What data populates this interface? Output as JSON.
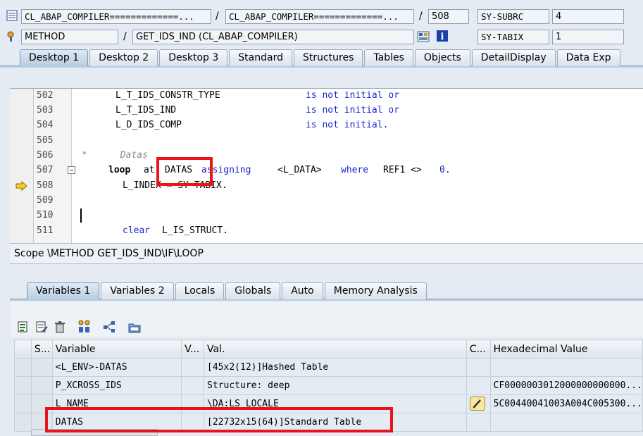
{
  "header": {
    "row1": {
      "program": "CL_ABAP_COMPILER=============...",
      "include": "CL_ABAP_COMPILER=============...",
      "line": "508",
      "var1_name": "SY-SUBRC",
      "var1_value": "4"
    },
    "row2": {
      "event_type": "METHOD",
      "event": "GET_IDS_IND (CL_ABAP_COMPILER)",
      "var2_name": "SY-TABIX",
      "var2_value": "1"
    },
    "separator": "/"
  },
  "desktop_tabs": [
    "Desktop 1",
    "Desktop 2",
    "Desktop 3",
    "Standard",
    "Structures",
    "Tables",
    "Objects",
    "DetailDisplay",
    "Data Exp"
  ],
  "code": {
    "lines": [
      {
        "num": "502",
        "left": "L_T_IDS_CONSTR_TYPE",
        "right": "is not initial or"
      },
      {
        "num": "503",
        "left": "L_T_IDS_IND",
        "right": "is not initial or"
      },
      {
        "num": "504",
        "left": "L_D_IDS_COMP",
        "right": "is not initial."
      },
      {
        "num": "505"
      },
      {
        "num": "506",
        "comment": "*      Datas"
      },
      {
        "num": "507",
        "kw_loop": "loop",
        "at": "at",
        "datas": "DATAS",
        "assigning": "assigning",
        "fs": "<L_DATA>",
        "where": "where",
        "cond": "REF1 <>",
        "zero": "0."
      },
      {
        "num": "508",
        "text": "L_INDEX = SY-TABIX."
      },
      {
        "num": "509"
      },
      {
        "num": "510"
      },
      {
        "num": "511",
        "kw": "clear",
        "text": "L_IS_STRUCT."
      }
    ]
  },
  "scope": "Scope \\METHOD GET_IDS_IND\\IF\\LOOP",
  "var_tabs": [
    "Variables 1",
    "Variables 2",
    "Locals",
    "Globals",
    "Auto",
    "Memory Analysis"
  ],
  "table": {
    "headers": [
      "S...",
      "Variable",
      "V...",
      "Val.",
      "C...",
      "Hexadecimal Value"
    ],
    "rows": [
      {
        "variable": "<L_ENV>-DATAS",
        "value": "[45x2(12)]Hashed Table",
        "hex": ""
      },
      {
        "variable": "P_XCROSS_IDS",
        "value": "Structure: deep",
        "hex": "CF0000003012000000000000..."
      },
      {
        "variable": "L_NAME",
        "value": "\\DA:LS_LOCALE",
        "hex": "5C00440041003A004C005300..."
      },
      {
        "variable": "DATAS",
        "value": "[22732x15(64)]Standard Table",
        "hex": ""
      }
    ]
  },
  "colors": {
    "highlight": "#e8141c",
    "keyword": "#1a27c9"
  }
}
